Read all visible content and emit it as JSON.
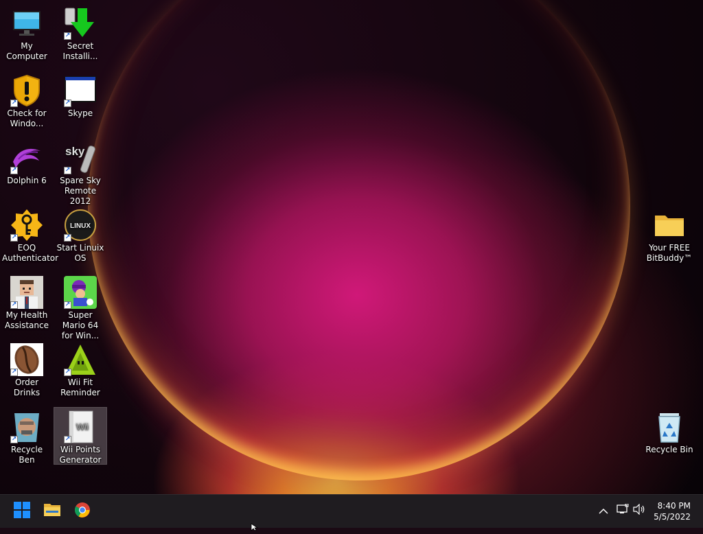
{
  "desktop": {
    "icons": [
      {
        "label": "My Computer",
        "icon": "monitor-icon"
      },
      {
        "label": "Secret Installi...",
        "icon": "download-arrow-icon"
      },
      {
        "label": "Check for Windo...",
        "icon": "shield-warning-icon"
      },
      {
        "label": "Skype",
        "icon": "window-icon"
      },
      {
        "label": "Dolphin 6",
        "icon": "dolphin-icon"
      },
      {
        "label": "Spare Sky Remote 2012",
        "icon": "sky-remote-icon"
      },
      {
        "label": "EOQ Authenticator",
        "icon": "key-badge-icon"
      },
      {
        "label": "Start Linuix OS",
        "icon": "linux-disc-icon"
      },
      {
        "label": "My Health Assistance",
        "icon": "doctor-icon"
      },
      {
        "label": "Super Mario 64 for Win...",
        "icon": "game-icon"
      },
      {
        "label": "Order Drinks",
        "icon": "coffee-bean-icon"
      },
      {
        "label": "Wii Fit Reminder",
        "icon": "triangle-icon"
      },
      {
        "label": "Recycle Ben",
        "icon": "ben-icon"
      },
      {
        "label": "Wii Points Generator",
        "icon": "wii-box-icon"
      },
      {
        "label": "Your FREE BitBuddy™",
        "icon": "folder-icon"
      },
      {
        "label": "Recycle Bin",
        "icon": "recycle-bin-icon"
      }
    ],
    "selected_icon": "Wii Points Generator",
    "wallpaper_colors": {
      "glow": "#d4177c",
      "rim": "#ffd83a",
      "dark": "#12050d"
    }
  },
  "icon_text": {
    "sky": "sky",
    "linux": "LINUX",
    "wii": "Wii",
    "shortcut_arrow": "↗"
  },
  "taskbar": {
    "pinned": [
      {
        "name": "Start",
        "icon": "windows-start-icon"
      },
      {
        "name": "File Explorer",
        "icon": "folder-icon"
      },
      {
        "name": "Google Chrome",
        "icon": "chrome-icon"
      }
    ],
    "tray": {
      "chevron": "^",
      "icons": [
        "network-icon",
        "volume-icon"
      ]
    },
    "clock": {
      "time": "8:40 PM",
      "date": "5/5/2022"
    },
    "accent": "#1e90ff",
    "background": "#1f1c20"
  }
}
